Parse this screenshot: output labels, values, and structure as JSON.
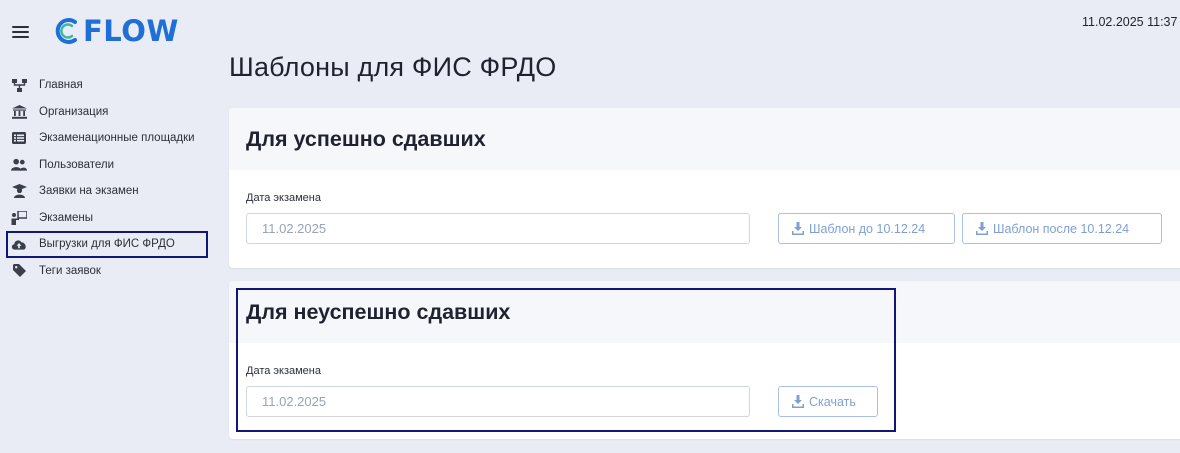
{
  "header": {
    "datetime": "11.02.2025 11:37"
  },
  "brand": {
    "name": "FLOW",
    "accent": "#1f6fd6"
  },
  "sidebar": {
    "items": [
      {
        "label": "Главная",
        "icon": "network-icon"
      },
      {
        "label": "Организация",
        "icon": "bank-icon"
      },
      {
        "label": "Экзаменационные площадки",
        "icon": "list-icon"
      },
      {
        "label": "Пользователи",
        "icon": "users-icon"
      },
      {
        "label": "Заявки на экзамен",
        "icon": "graduate-icon"
      },
      {
        "label": "Экзамены",
        "icon": "presenter-icon"
      },
      {
        "label": "Выгрузки для ФИС ФРДО",
        "icon": "cloud-upload-icon",
        "active": true
      },
      {
        "label": "Теги заявок",
        "icon": "tag-icon"
      }
    ]
  },
  "main": {
    "title": "Шаблоны для ФИС ФРДО",
    "passed": {
      "title": "Для успешно сдавших",
      "date_label": "Дата экзамена",
      "date_value": "11.02.2025",
      "btn_before": "Шаблон до 10.12.24",
      "btn_after": "Шаблон после 10.12.24"
    },
    "failed": {
      "title": "Для неуспешно сдавших",
      "date_label": "Дата экзамена",
      "date_value": "11.02.2025",
      "btn_download": "Скачать"
    }
  },
  "colors": {
    "highlight": "#101779",
    "button_text": "#7f9fd4"
  }
}
